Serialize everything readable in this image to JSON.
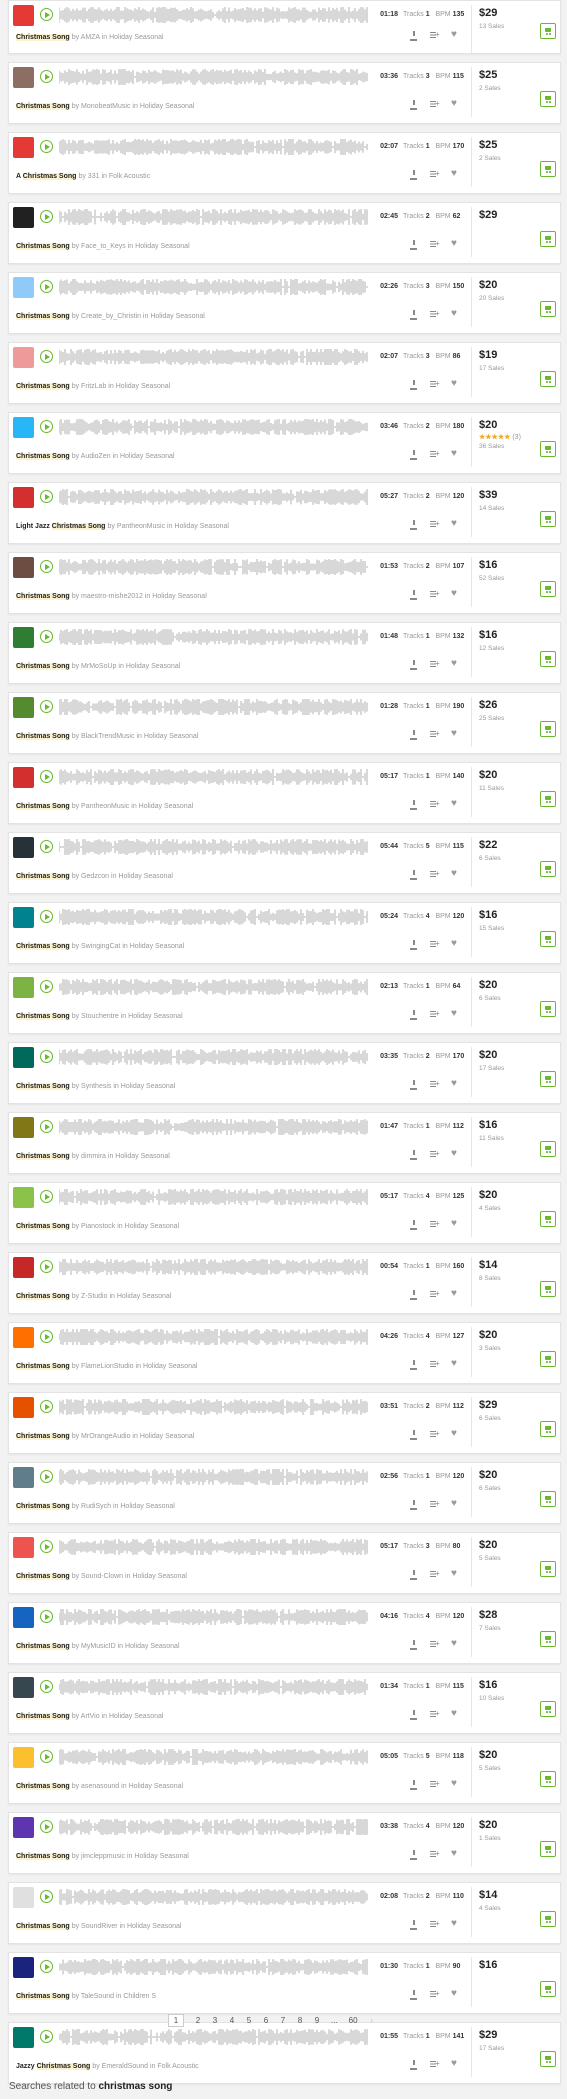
{
  "labels": {
    "tracks": "Tracks",
    "bpm": "BPM",
    "by": "by",
    "in": "in"
  },
  "icons": {
    "play": "play-icon",
    "download": "download-icon",
    "add_to_playlist": "add-to-playlist-icon",
    "favorite": "heart-icon",
    "cart": "cart-icon"
  },
  "colors": {
    "accent": "#6ab82d",
    "highlight": "#fbf2cf",
    "waveform": "#cfcfcf",
    "star": "#f5a623"
  },
  "tracks": [
    {
      "pre": "",
      "hl": "Christmas Song",
      "author": "AMZA",
      "genre": "Holiday Seasonal",
      "duration": "01:18",
      "tracks": "1",
      "bpm": "135",
      "price": "$29",
      "sales": "13 Sales",
      "thumb": "#e53935"
    },
    {
      "pre": "",
      "hl": "Christmas Song",
      "author": "MonobeatMusic",
      "genre": "Holiday Seasonal",
      "duration": "03:36",
      "tracks": "3",
      "bpm": "115",
      "price": "$25",
      "sales": "2 Sales",
      "thumb": "#8d6e63"
    },
    {
      "pre": "A ",
      "hl": "Christmas Song",
      "author": "331",
      "genre": "Folk Acoustic",
      "duration": "02:07",
      "tracks": "1",
      "bpm": "170",
      "price": "$25",
      "sales": "2 Sales",
      "thumb": "#e53935"
    },
    {
      "pre": "",
      "hl": "Christmas Song",
      "author": "Face_to_Keys",
      "genre": "Holiday Seasonal",
      "duration": "02:45",
      "tracks": "2",
      "bpm": "62",
      "price": "$29",
      "sales": "",
      "thumb": "#212121"
    },
    {
      "pre": "",
      "hl": "Christmas Song",
      "author": "Create_by_Christin",
      "genre": "Holiday Seasonal",
      "duration": "02:26",
      "tracks": "3",
      "bpm": "150",
      "price": "$20",
      "sales": "20 Sales",
      "thumb": "#90caf9"
    },
    {
      "pre": "",
      "hl": "Christmas Song",
      "author": "FritzLab",
      "genre": "Holiday Seasonal",
      "duration": "02:07",
      "tracks": "3",
      "bpm": "86",
      "price": "$19",
      "sales": "17 Sales",
      "thumb": "#ef9a9a"
    },
    {
      "pre": "",
      "hl": "Christmas Song",
      "author": "AudioZen",
      "genre": "Holiday Seasonal",
      "duration": "03:46",
      "tracks": "2",
      "bpm": "180",
      "price": "$20",
      "sales": "36 Sales",
      "thumb": "#29b6f6",
      "rating": "★★★★★",
      "rating_count": "(3)"
    },
    {
      "pre": "Light Jazz ",
      "hl": "Christmas Song",
      "author": "PantheonMusic",
      "genre": "Holiday Seasonal",
      "duration": "05:27",
      "tracks": "2",
      "bpm": "120",
      "price": "$39",
      "sales": "14 Sales",
      "thumb": "#d32f2f"
    },
    {
      "pre": "",
      "hl": "Christmas Song",
      "author": "maestro-mishe2012",
      "genre": "Holiday Seasonal",
      "duration": "01:53",
      "tracks": "2",
      "bpm": "107",
      "price": "$16",
      "sales": "52 Sales",
      "thumb": "#6d4c41"
    },
    {
      "pre": "",
      "hl": "Christmas Song",
      "author": "MrMoSoUp",
      "genre": "Holiday Seasonal",
      "duration": "01:48",
      "tracks": "1",
      "bpm": "132",
      "price": "$16",
      "sales": "12 Sales",
      "thumb": "#2e7d32"
    },
    {
      "pre": "",
      "hl": "Christmas Song",
      "author": "BlackTrendMusic",
      "genre": "Holiday Seasonal",
      "duration": "01:28",
      "tracks": "1",
      "bpm": "190",
      "price": "$26",
      "sales": "25 Sales",
      "thumb": "#558b2f"
    },
    {
      "pre": "",
      "hl": "Christmas Song",
      "author": "PantheonMusic",
      "genre": "Holiday Seasonal",
      "duration": "05:17",
      "tracks": "1",
      "bpm": "140",
      "price": "$20",
      "sales": "11 Sales",
      "thumb": "#d32f2f"
    },
    {
      "pre": "",
      "hl": "Christmas Song",
      "author": "Gedzcon",
      "genre": "Holiday Seasonal",
      "duration": "05:44",
      "tracks": "5",
      "bpm": "115",
      "price": "$22",
      "sales": "6 Sales",
      "thumb": "#263238"
    },
    {
      "pre": "",
      "hl": "Christmas Song",
      "author": "SwingingCat",
      "genre": "Holiday Seasonal",
      "duration": "05:24",
      "tracks": "4",
      "bpm": "120",
      "price": "$16",
      "sales": "15 Sales",
      "thumb": "#00838f"
    },
    {
      "pre": "",
      "hl": "Christmas Song",
      "author": "Stouchentre",
      "genre": "Holiday Seasonal",
      "duration": "02:13",
      "tracks": "1",
      "bpm": "64",
      "price": "$20",
      "sales": "6 Sales",
      "thumb": "#7cb342"
    },
    {
      "pre": "",
      "hl": "Christmas Song",
      "author": "Synthesis",
      "genre": "Holiday Seasonal",
      "duration": "03:35",
      "tracks": "2",
      "bpm": "170",
      "price": "$20",
      "sales": "17 Sales",
      "thumb": "#00695c"
    },
    {
      "pre": "",
      "hl": "Christmas Song",
      "author": "dimmira",
      "genre": "Holiday Seasonal",
      "duration": "01:47",
      "tracks": "1",
      "bpm": "112",
      "price": "$16",
      "sales": "11 Sales",
      "thumb": "#827717"
    },
    {
      "pre": "",
      "hl": "Christmas Song",
      "author": "Pianostock",
      "genre": "Holiday Seasonal",
      "duration": "05:17",
      "tracks": "4",
      "bpm": "125",
      "price": "$20",
      "sales": "4 Sales",
      "thumb": "#8bc34a"
    },
    {
      "pre": "",
      "hl": "Christmas Song",
      "author": "Z-Studio",
      "genre": "Holiday Seasonal",
      "duration": "00:54",
      "tracks": "1",
      "bpm": "160",
      "price": "$14",
      "sales": "8 Sales",
      "thumb": "#c62828"
    },
    {
      "pre": "",
      "hl": "Christmas Song",
      "author": "FlameLionStudio",
      "genre": "Holiday Seasonal",
      "duration": "04:26",
      "tracks": "4",
      "bpm": "127",
      "price": "$20",
      "sales": "3 Sales",
      "thumb": "#ff6f00"
    },
    {
      "pre": "",
      "hl": "Christmas Song",
      "author": "MrOrangeAudio",
      "genre": "Holiday Seasonal",
      "duration": "03:51",
      "tracks": "2",
      "bpm": "112",
      "price": "$29",
      "sales": "6 Sales",
      "thumb": "#e65100"
    },
    {
      "pre": "",
      "hl": "Christmas Song",
      "author": "RudiSych",
      "genre": "Holiday Seasonal",
      "duration": "02:56",
      "tracks": "1",
      "bpm": "120",
      "price": "$20",
      "sales": "6 Sales",
      "thumb": "#607d8b"
    },
    {
      "pre": "",
      "hl": "Christmas Song",
      "author": "Sound-Clown",
      "genre": "Holiday Seasonal",
      "duration": "05:17",
      "tracks": "3",
      "bpm": "80",
      "price": "$20",
      "sales": "5 Sales",
      "thumb": "#ef5350"
    },
    {
      "pre": "",
      "hl": "Christmas Song",
      "author": "MyMusicID",
      "genre": "Holiday Seasonal",
      "duration": "04:16",
      "tracks": "4",
      "bpm": "120",
      "price": "$28",
      "sales": "7 Sales",
      "thumb": "#1565c0"
    },
    {
      "pre": "",
      "hl": "Christmas Song",
      "author": "ArtVio",
      "genre": "Holiday Seasonal",
      "duration": "01:34",
      "tracks": "1",
      "bpm": "115",
      "price": "$16",
      "sales": "10 Sales",
      "thumb": "#37474f"
    },
    {
      "pre": "",
      "hl": "Christmas Song",
      "author": "asenasound",
      "genre": "Holiday Seasonal",
      "duration": "05:05",
      "tracks": "5",
      "bpm": "118",
      "price": "$20",
      "sales": "5 Sales",
      "thumb": "#fbc02d"
    },
    {
      "pre": "",
      "hl": "Christmas Song",
      "author": "jimcleppmusic",
      "genre": "Holiday Seasonal",
      "duration": "03:38",
      "tracks": "4",
      "bpm": "120",
      "price": "$20",
      "sales": "1 Sales",
      "thumb": "#5e35b1"
    },
    {
      "pre": "",
      "hl": "Christmas Song",
      "author": "SoundRiver",
      "genre": "Holiday Seasonal",
      "duration": "02:08",
      "tracks": "2",
      "bpm": "110",
      "price": "$14",
      "sales": "4 Sales",
      "thumb": "#e0e0e0"
    },
    {
      "pre": "",
      "hl": "Christmas Song",
      "author": "TaleSound",
      "genre": "Children S",
      "duration": "01:30",
      "tracks": "1",
      "bpm": "90",
      "price": "$16",
      "sales": "",
      "thumb": "#1a237e"
    },
    {
      "pre": "Jazzy ",
      "hl": "Christmas Song",
      "author": "EmeraldSound",
      "genre": "Folk Acoustic",
      "duration": "01:55",
      "tracks": "1",
      "bpm": "141",
      "price": "$29",
      "sales": "17 Sales",
      "thumb": "#00796b"
    }
  ],
  "pagination": {
    "pages": [
      "1",
      "2",
      "3",
      "4",
      "5",
      "6",
      "7",
      "8",
      "9",
      "...",
      "60"
    ],
    "current": "1",
    "next": "›"
  },
  "related": {
    "prefix": "Searches related to",
    "term": "christmas song"
  }
}
